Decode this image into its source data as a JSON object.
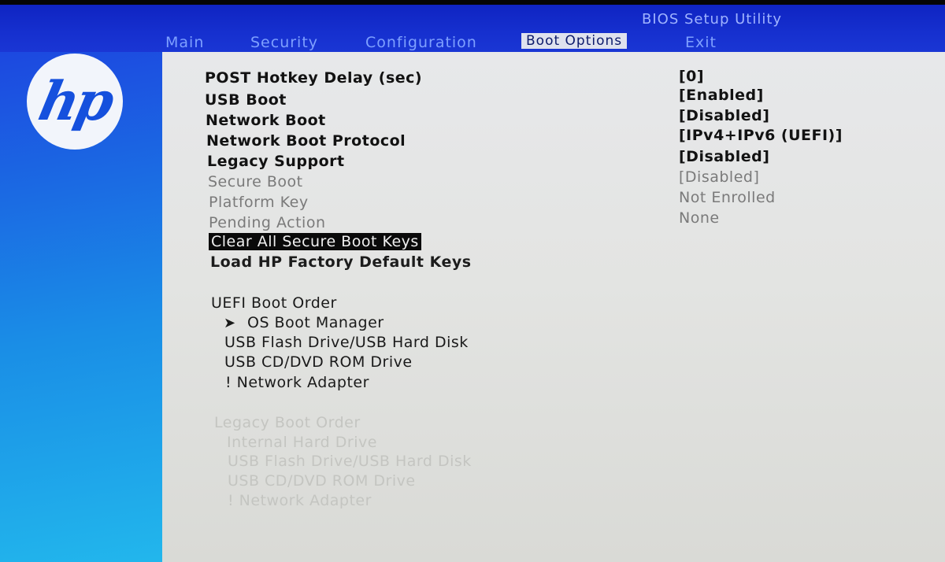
{
  "header": {
    "utility_title": "BIOS Setup Utility",
    "tabs": [
      {
        "label": "Main"
      },
      {
        "label": "Security"
      },
      {
        "label": "Configuration"
      },
      {
        "label": "Boot Options",
        "active": true
      },
      {
        "label": "Exit"
      }
    ]
  },
  "logo": {
    "text": "hp",
    "icon": "hp-logo-icon"
  },
  "settings": [
    {
      "label": "POST Hotkey Delay (sec)",
      "value": "[0]"
    },
    {
      "label": "USB Boot",
      "value": "[Enabled]"
    },
    {
      "label": "Network Boot",
      "value": "[Disabled]"
    },
    {
      "label": "Network Boot Protocol",
      "value": "[IPv4+IPv6 (UEFI)]"
    },
    {
      "label": "Legacy Support",
      "value": "[Disabled]"
    },
    {
      "label": "Secure Boot",
      "value": "[Disabled]"
    },
    {
      "label": "Platform Key",
      "value": "Not Enrolled"
    },
    {
      "label": "Pending Action",
      "value": "None"
    }
  ],
  "actions": [
    {
      "label": "Clear All Secure Boot Keys",
      "selected": true
    },
    {
      "label": "Load HP Factory Default Keys"
    }
  ],
  "uefi_boot_order": {
    "heading": "UEFI Boot Order",
    "arrow_icon": "arrow-right-icon",
    "items": [
      "OS Boot Manager",
      "USB Flash Drive/USB Hard Disk",
      "USB CD/DVD ROM Drive",
      "! Network Adapter"
    ]
  },
  "legacy_boot_order": {
    "heading": "Legacy Boot Order",
    "items": [
      "Internal Hard Drive",
      "USB Flash Drive/USB Hard Disk",
      "USB CD/DVD ROM Drive",
      "! Network Adapter"
    ]
  },
  "colors": {
    "header_blue": "#1630cf",
    "sidebar_blue": "#1a8ee6",
    "panel_grey": "#e3e4e2",
    "selection_black": "#0a0a0a"
  }
}
